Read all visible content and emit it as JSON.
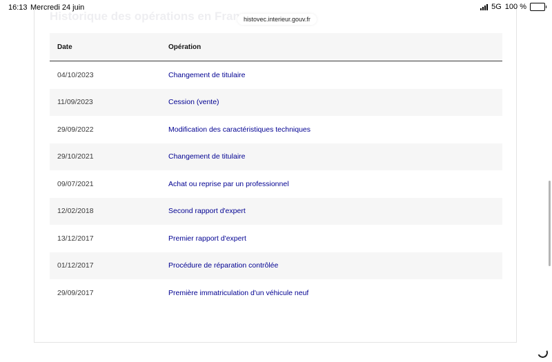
{
  "status_bar": {
    "time": "16:13",
    "date": "Mercredi 24 juin",
    "network": "5G",
    "battery": "100 %",
    "battery_level": 1.0
  },
  "browser": {
    "url": "histovec.interieur.gouv.fr"
  },
  "page": {
    "heading": "Historique des opérations en France"
  },
  "table": {
    "headers": {
      "date": "Date",
      "operation": "Opération"
    },
    "rows": [
      {
        "date": "04/10/2023",
        "operation": "Changement de titulaire"
      },
      {
        "date": "11/09/2023",
        "operation": "Cession (vente)"
      },
      {
        "date": "29/09/2022",
        "operation": "Modification des caractéristiques techniques"
      },
      {
        "date": "29/10/2021",
        "operation": "Changement de titulaire"
      },
      {
        "date": "09/07/2021",
        "operation": "Achat ou reprise par un professionnel"
      },
      {
        "date": "12/02/2018",
        "operation": "Second rapport d'expert"
      },
      {
        "date": "13/12/2017",
        "operation": "Premier rapport d'expert"
      },
      {
        "date": "01/12/2017",
        "operation": "Procédure de réparation contrôlée"
      },
      {
        "date": "29/09/2017",
        "operation": "Première immatriculation d'un véhicule neuf"
      }
    ]
  },
  "colors": {
    "link": "#000091",
    "row_alt": "#f6f6f6"
  }
}
